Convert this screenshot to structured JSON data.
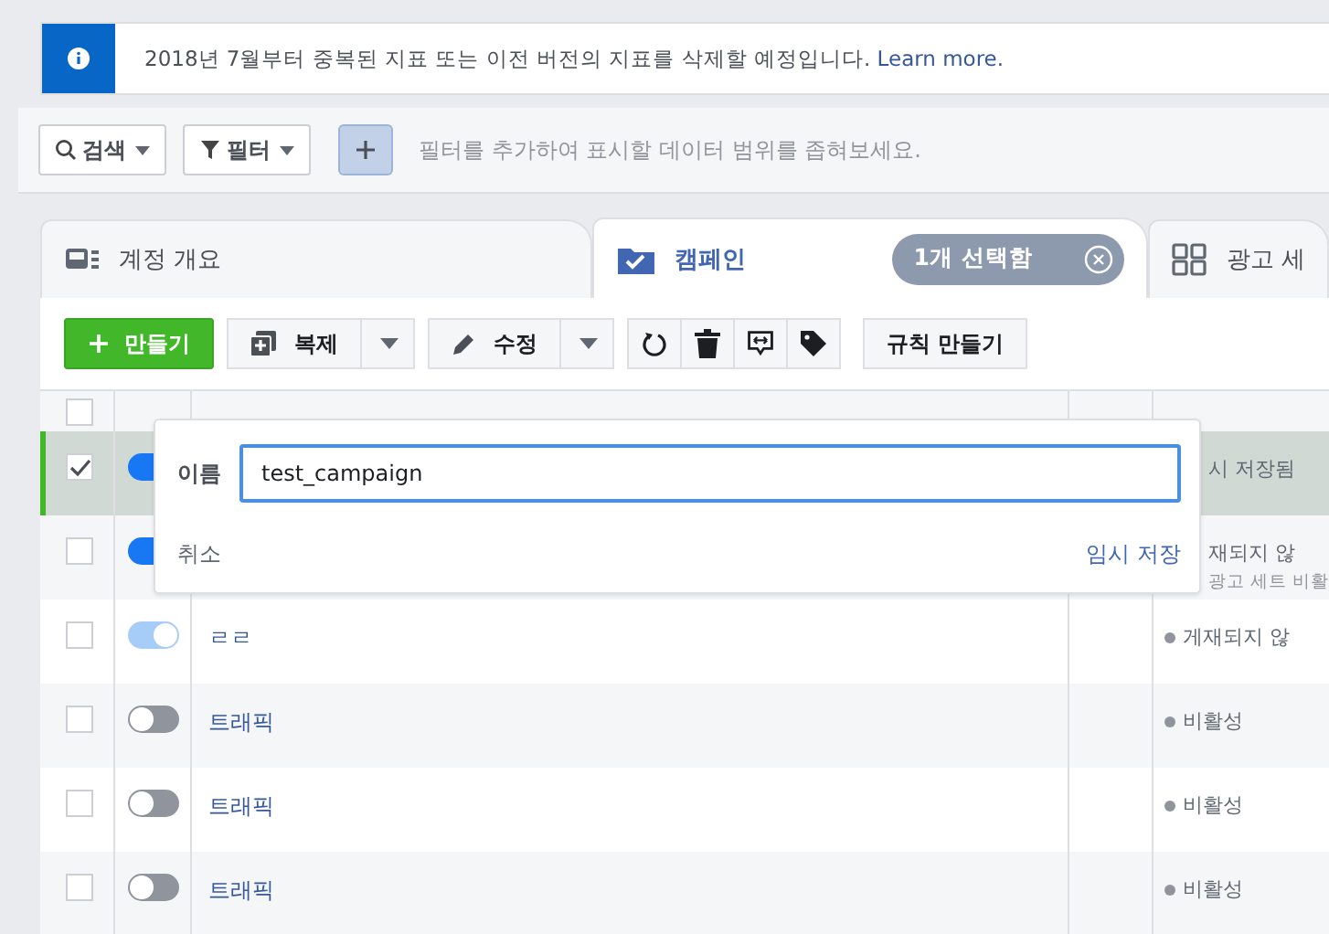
{
  "banner": {
    "text": "2018년 7월부터 중복된 지표 또는 이전 버전의 지표를 삭제할 예정입니다.",
    "link": "Learn more."
  },
  "filter_bar": {
    "search_label": "검색",
    "filter_label": "필터",
    "hint": "필터를 추가하여 표시할 데이터 범위를 좁혀보세요."
  },
  "tabs": [
    {
      "kind": "account",
      "label": "계정 개요",
      "selected": false
    },
    {
      "kind": "campaign",
      "label": "캠페인",
      "selected": true,
      "badge": "1개 선택함"
    },
    {
      "kind": "adset",
      "label": "광고 세",
      "selected": false
    }
  ],
  "toolbar": {
    "create": "만들기",
    "duplicate": "복제",
    "edit": "수정",
    "rule": "규칙 만들기"
  },
  "select_all_checked": false,
  "rows": [
    {
      "selected": true,
      "checked": true,
      "on": true,
      "disabled": false,
      "name": "",
      "status": "시 저장됨",
      "sub": ""
    },
    {
      "selected": false,
      "checked": false,
      "on": true,
      "disabled": false,
      "name": "",
      "status": "재되지 않",
      "sub": "광고 세트 비활"
    },
    {
      "selected": false,
      "checked": false,
      "on": true,
      "disabled": true,
      "name": "ㄹㄹ",
      "status": "게재되지 않",
      "sub": ""
    },
    {
      "selected": false,
      "checked": false,
      "on": false,
      "name": "트래픽",
      "status": "비활성",
      "sub": ""
    },
    {
      "selected": false,
      "checked": false,
      "on": false,
      "name": "트래픽",
      "status": "비활성",
      "sub": ""
    },
    {
      "selected": false,
      "checked": false,
      "on": false,
      "name": "트래픽",
      "status": "비활성",
      "sub": ""
    }
  ],
  "popup": {
    "label": "이름",
    "value": "test_campaign",
    "cancel": "취소",
    "save": "임시 저장"
  }
}
